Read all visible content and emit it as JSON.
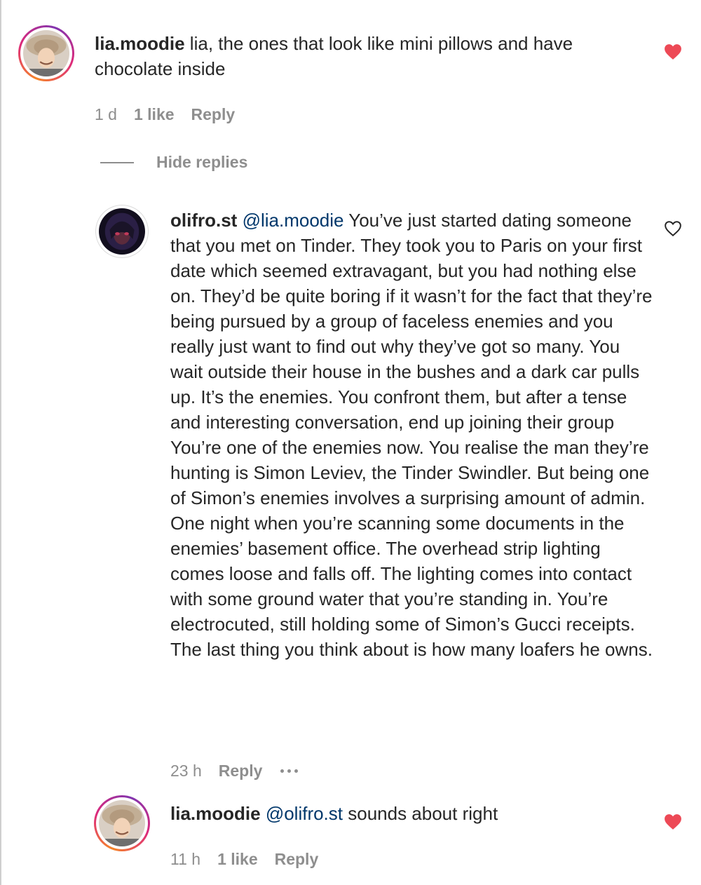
{
  "comments": [
    {
      "username": "lia.moodie",
      "mention": "",
      "text": " lia, the ones that look like mini pillows and have chocolate inside",
      "time": "1 d",
      "likes": "1 like",
      "reply": "Reply",
      "liked": true
    },
    {
      "username": "olifro.st",
      "mention": "@lia.moodie",
      "text": " You’ve just started dating someone that you met on Tinder. They took you to Paris on your first date which seemed extravagant, but you had nothing else on. They’d be quite boring if it wasn’t for the fact that they’re being pursued by a group of faceless enemies and you really just want to find out why they’ve got so many. You wait outside their house in the bushes and a dark car pulls up. It’s the enemies. You confront them, but after a tense and interesting conversation, end up joining their group You’re one of the enemies now. You realise the man they’re hunting is Simon Leviev, the Tinder Swindler. But being one of Simon’s enemies involves a surprising amount of admin. One night when you’re scanning some documents in the enemies’ basement office. The overhead strip lighting comes loose and falls off. The lighting comes into contact with some ground water that you’re standing in. You’re electrocuted, still holding some of Simon’s Gucci receipts. The last thing you think about is how many loafers he owns.",
      "time": "23 h",
      "reply": "Reply",
      "liked": false
    },
    {
      "username": "lia.moodie",
      "mention": "@olifro.st",
      "text": " sounds about right",
      "time": "11 h",
      "likes": "1 like",
      "reply": "Reply",
      "liked": true
    }
  ],
  "thread": {
    "hide_replies": "Hide replies"
  },
  "colors": {
    "heart_red": "#ed4956",
    "mention": "#00376b",
    "meta": "#8e8e8e"
  },
  "icons": {
    "liked": "heart-filled-icon",
    "unliked": "heart-outline-icon",
    "more": "more-options-icon"
  }
}
